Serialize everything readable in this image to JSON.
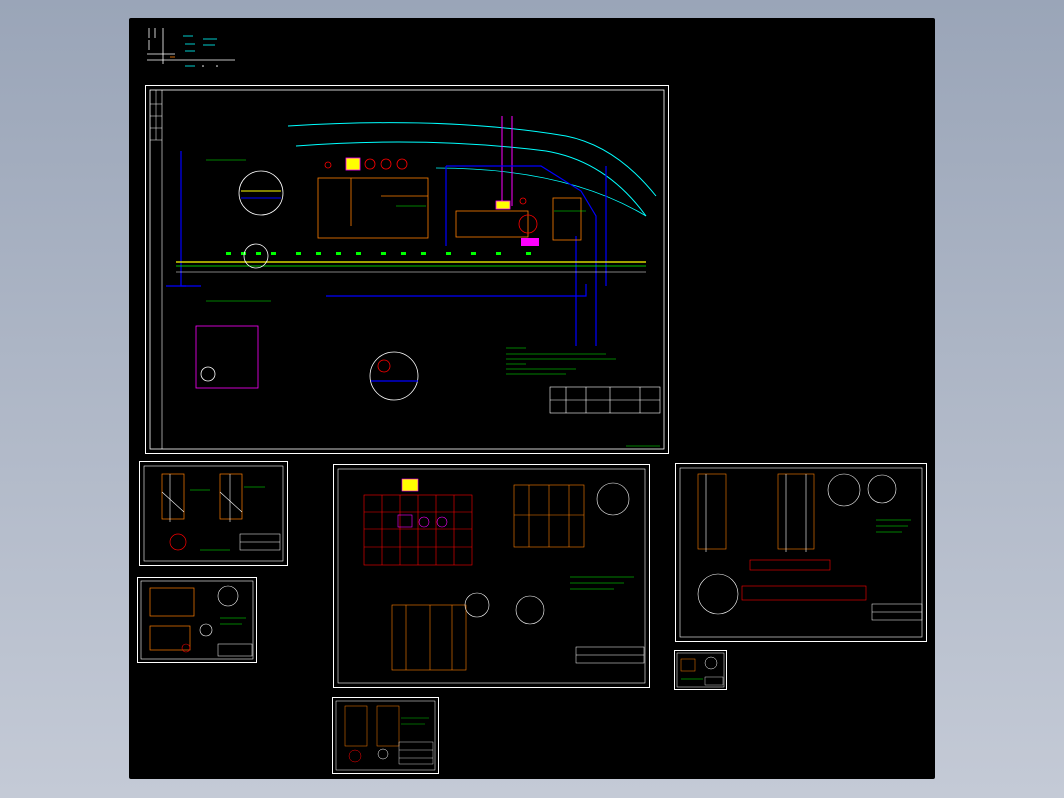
{
  "app": {
    "viewport_background": "#000000",
    "frame_colors": {
      "white": "#ffffff",
      "green": "#00ff00",
      "cyan": "#00ffff",
      "blue": "#0000ff",
      "red": "#ff0000",
      "magenta": "#ff00ff",
      "yellow": "#ffff00",
      "orange": "#ff7f00",
      "olive": "#808000"
    }
  },
  "drawings": [
    {
      "id": "legend",
      "title": ""
    },
    {
      "id": "main-plan",
      "title": ""
    },
    {
      "id": "detail-a",
      "title": ""
    },
    {
      "id": "detail-b",
      "title": ""
    },
    {
      "id": "plan-elev",
      "title": ""
    },
    {
      "id": "right-details",
      "title": ""
    },
    {
      "id": "small-detail",
      "title": ""
    },
    {
      "id": "bottom-detail",
      "title": ""
    }
  ]
}
